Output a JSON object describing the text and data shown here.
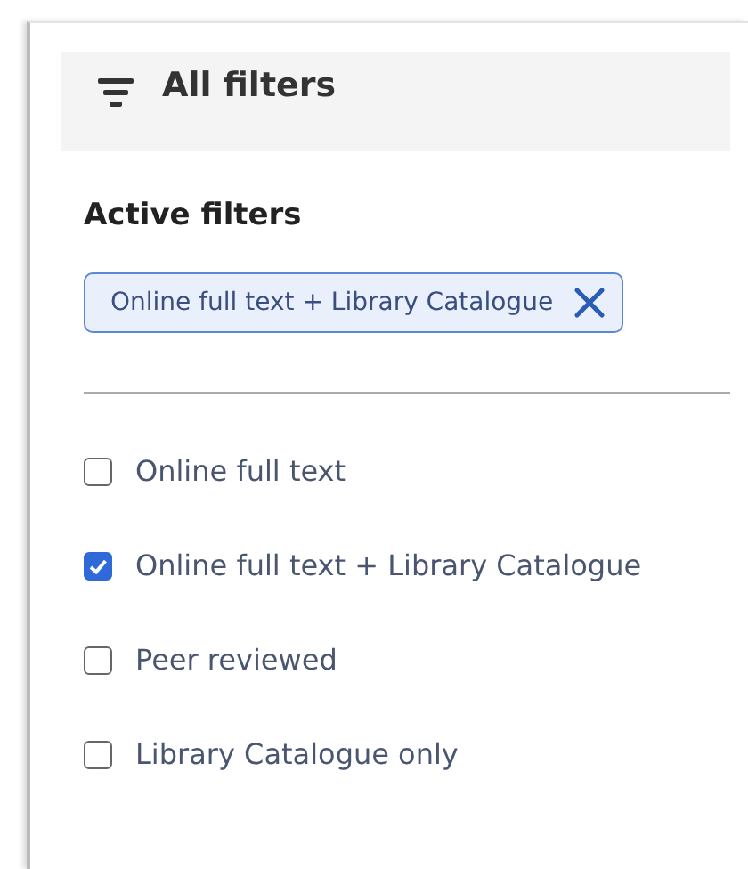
{
  "header": {
    "title": "All filters"
  },
  "active_filters": {
    "heading": "Active filters",
    "chips": [
      {
        "label": "Online full text + Library Catalogue"
      }
    ]
  },
  "options": [
    {
      "label": "Online full text",
      "checked": false
    },
    {
      "label": "Online full text + Library Catalogue",
      "checked": true
    },
    {
      "label": "Peer reviewed",
      "checked": false
    },
    {
      "label": "Library Catalogue only",
      "checked": false
    }
  ]
}
